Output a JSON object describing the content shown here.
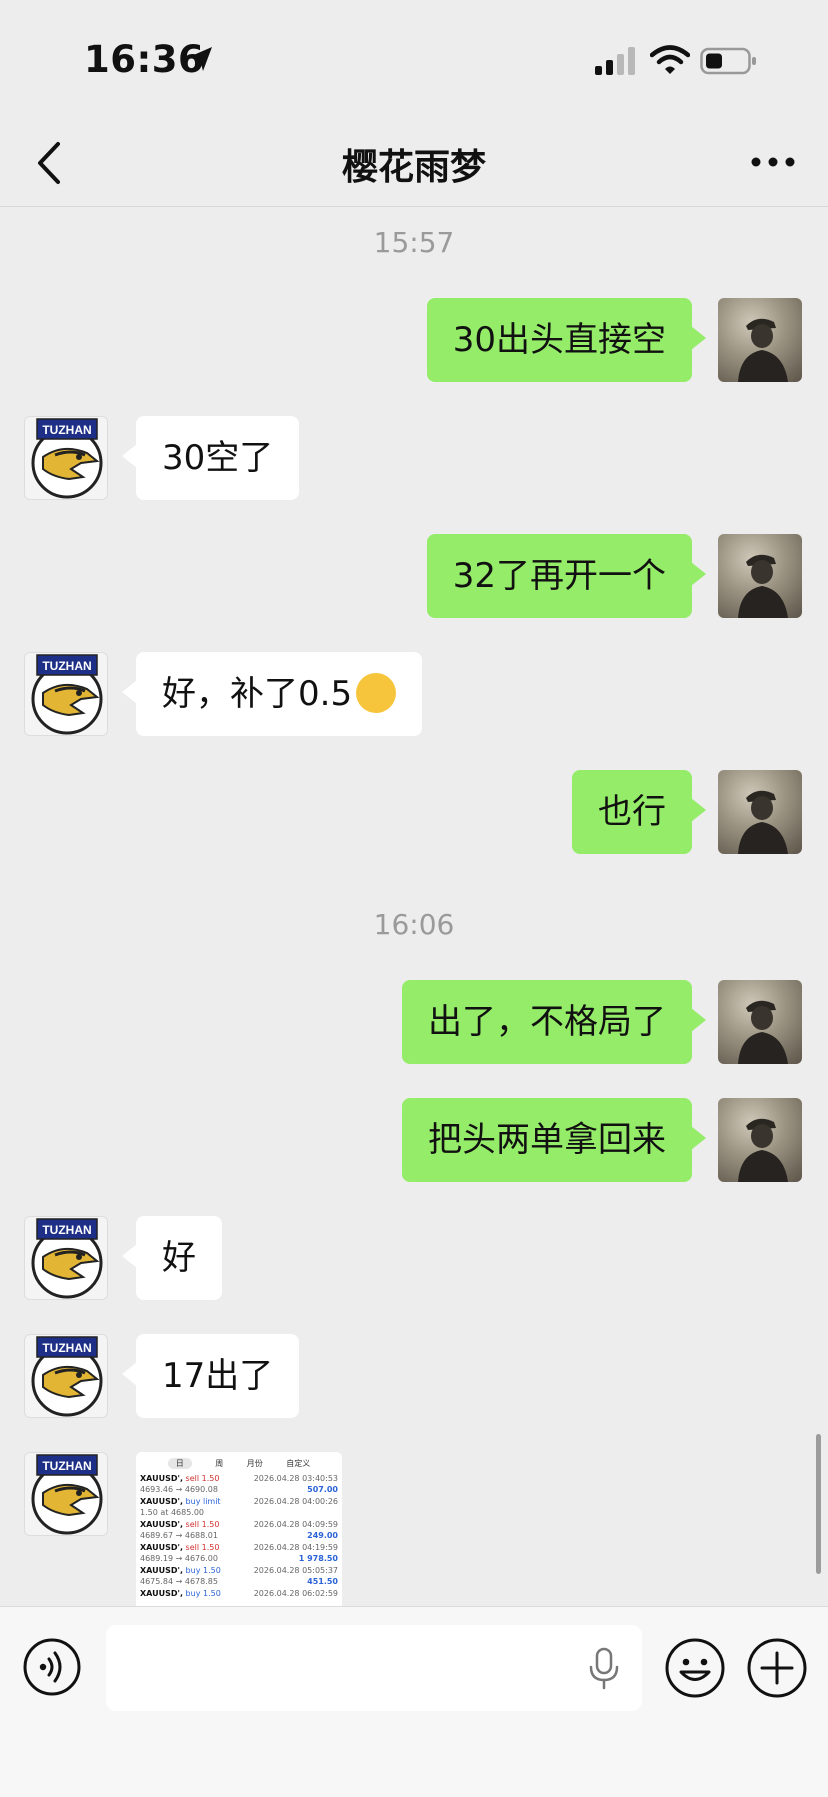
{
  "status_bar": {
    "time": "16:36"
  },
  "nav": {
    "title": "樱花雨梦"
  },
  "timestamps": [
    "15:57",
    "16:06"
  ],
  "logo_text": "TUZHAN",
  "messages": [
    {
      "side": "me",
      "text": "30出头直接空"
    },
    {
      "side": "other",
      "text": "30空了"
    },
    {
      "side": "me",
      "text": "32了再开一个"
    },
    {
      "side": "other",
      "text": "好，补了0.5"
    },
    {
      "side": "me",
      "text": "也行"
    },
    {
      "side": "me",
      "text": "出了，不格局了"
    },
    {
      "side": "me",
      "text": "把头两单拿回来"
    },
    {
      "side": "other",
      "text": "好"
    },
    {
      "side": "other",
      "text": "17出了"
    }
  ],
  "image_message": {
    "tabs": [
      "日",
      "周",
      "月份",
      "自定义"
    ],
    "trades": [
      {
        "symbol": "XAUUSD',",
        "action": "sell 1.50",
        "datetime": "2026.04.28 03:40:53",
        "prices": "4693.46 → 4690.08",
        "profit": "507.00"
      },
      {
        "symbol": "XAUUSD',",
        "action": "buy limit",
        "datetime": "2026.04.28 04:00:26",
        "prices": "1.50 at 4685.00",
        "profit": ""
      },
      {
        "symbol": "XAUUSD',",
        "action": "sell 1.50",
        "datetime": "2026.04.28 04:09:59",
        "prices": "4689.67 → 4688.01",
        "profit": "249.00"
      },
      {
        "symbol": "XAUUSD',",
        "action": "sell 1.50",
        "datetime": "2026.04.28 04:19:59",
        "prices": "4689.19 → 4676.00",
        "profit": "1 978.50"
      },
      {
        "symbol": "XAUUSD',",
        "action": "buy 1.50",
        "datetime": "2026.04.28 05:05:37",
        "prices": "4675.84 → 4678.85",
        "profit": "451.50"
      },
      {
        "symbol": "XAUUSD',",
        "action": "buy 1.50",
        "datetime": "2026.04.28 06:02:59",
        "prices": "",
        "profit": ""
      }
    ]
  },
  "icons": {
    "location": "location-arrow-icon",
    "signal": "cellular-signal-icon",
    "wifi": "wifi-icon",
    "battery": "battery-icon",
    "back": "chevron-left-icon",
    "more": "more-dots-icon",
    "voice": "voice-icon",
    "mic": "microphone-icon",
    "emoji": "smiley-icon",
    "plus": "plus-icon"
  },
  "colors": {
    "background": "#ededed",
    "my_bubble": "#95ec69",
    "other_bubble": "#ffffff"
  }
}
